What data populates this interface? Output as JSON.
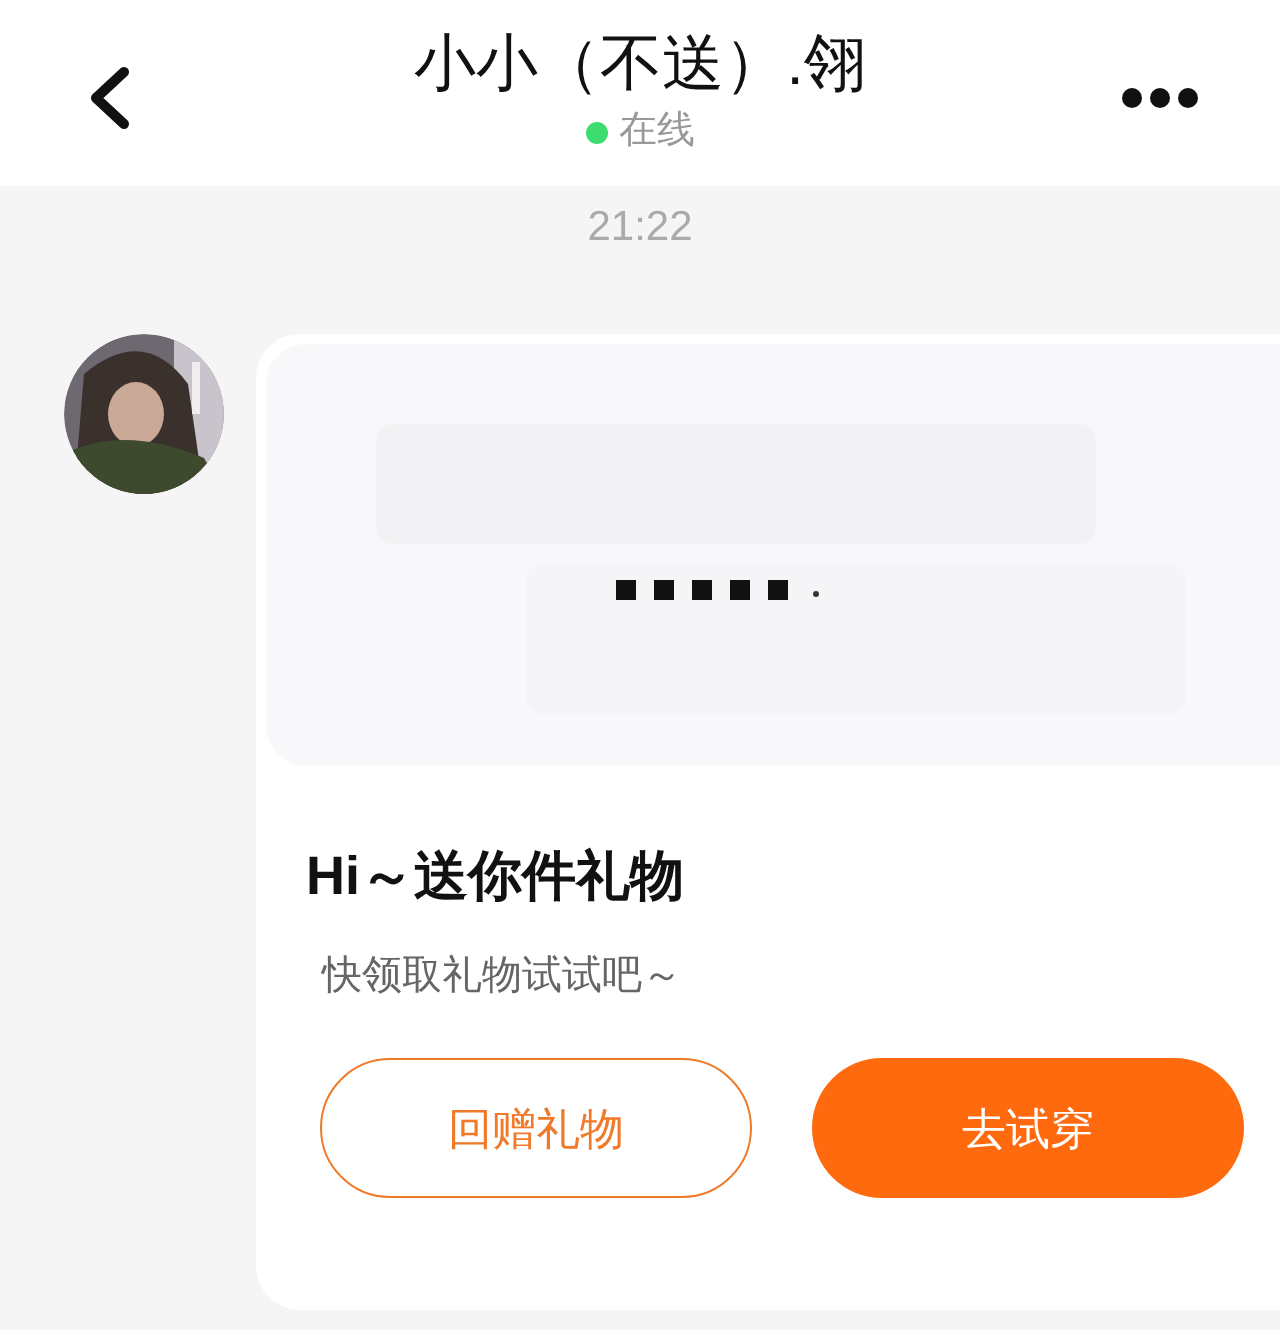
{
  "header": {
    "title": "小小（不送）.翎",
    "status": "在线",
    "online": true
  },
  "time": "21:22",
  "gift_card": {
    "title": "Hi～送你件礼物",
    "subtitle": "快领取礼物试试吧～",
    "buttons": [
      {
        "label": "回赠礼物",
        "kind": "outline"
      },
      {
        "label": "去试穿",
        "kind": "filled"
      }
    ]
  }
}
